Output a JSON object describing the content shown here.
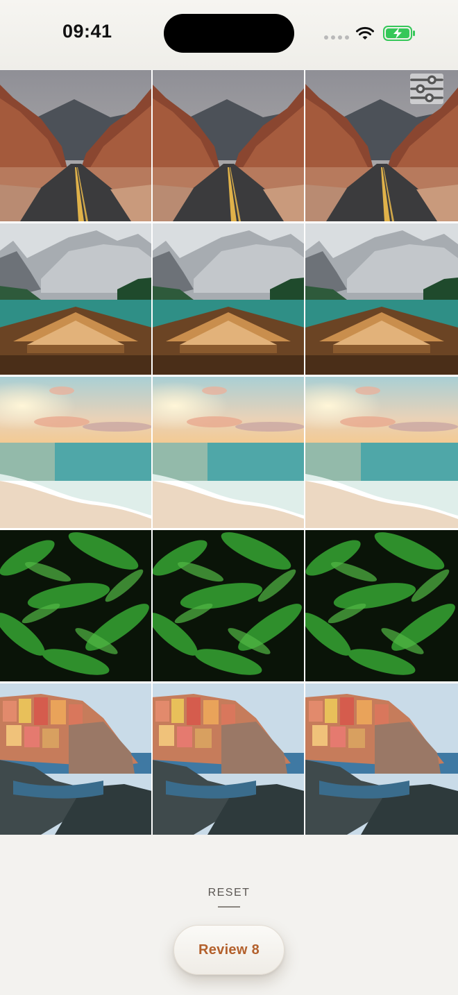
{
  "status_bar": {
    "time": "09:41",
    "icons": [
      "signal-dots-icon",
      "wifi-icon",
      "battery-charging-icon"
    ],
    "battery_color": "#35c759"
  },
  "grid": {
    "columns": 3,
    "rows": [
      {
        "scene": "desert-road",
        "photos": [
          "desert-road-photo",
          "desert-road-photo",
          "desert-road-photo"
        ]
      },
      {
        "scene": "lake-boat",
        "photos": [
          "lake-boat-photo",
          "lake-boat-photo",
          "lake-boat-photo"
        ]
      },
      {
        "scene": "beach-sunset",
        "photos": [
          "beach-sunset-photo",
          "beach-sunset-photo",
          "beach-sunset-photo"
        ]
      },
      {
        "scene": "ferns",
        "photos": [
          "ferns-photo",
          "ferns-photo",
          "ferns-photo"
        ]
      },
      {
        "scene": "cliff-village",
        "photos": [
          "cliff-village-photo",
          "cliff-village-photo",
          "cliff-village-photo"
        ]
      }
    ],
    "filter_icon": "sliders-icon"
  },
  "actions": {
    "reset_label": "RESET",
    "review_label": "Review 8",
    "accent_color": "#b3602c"
  }
}
